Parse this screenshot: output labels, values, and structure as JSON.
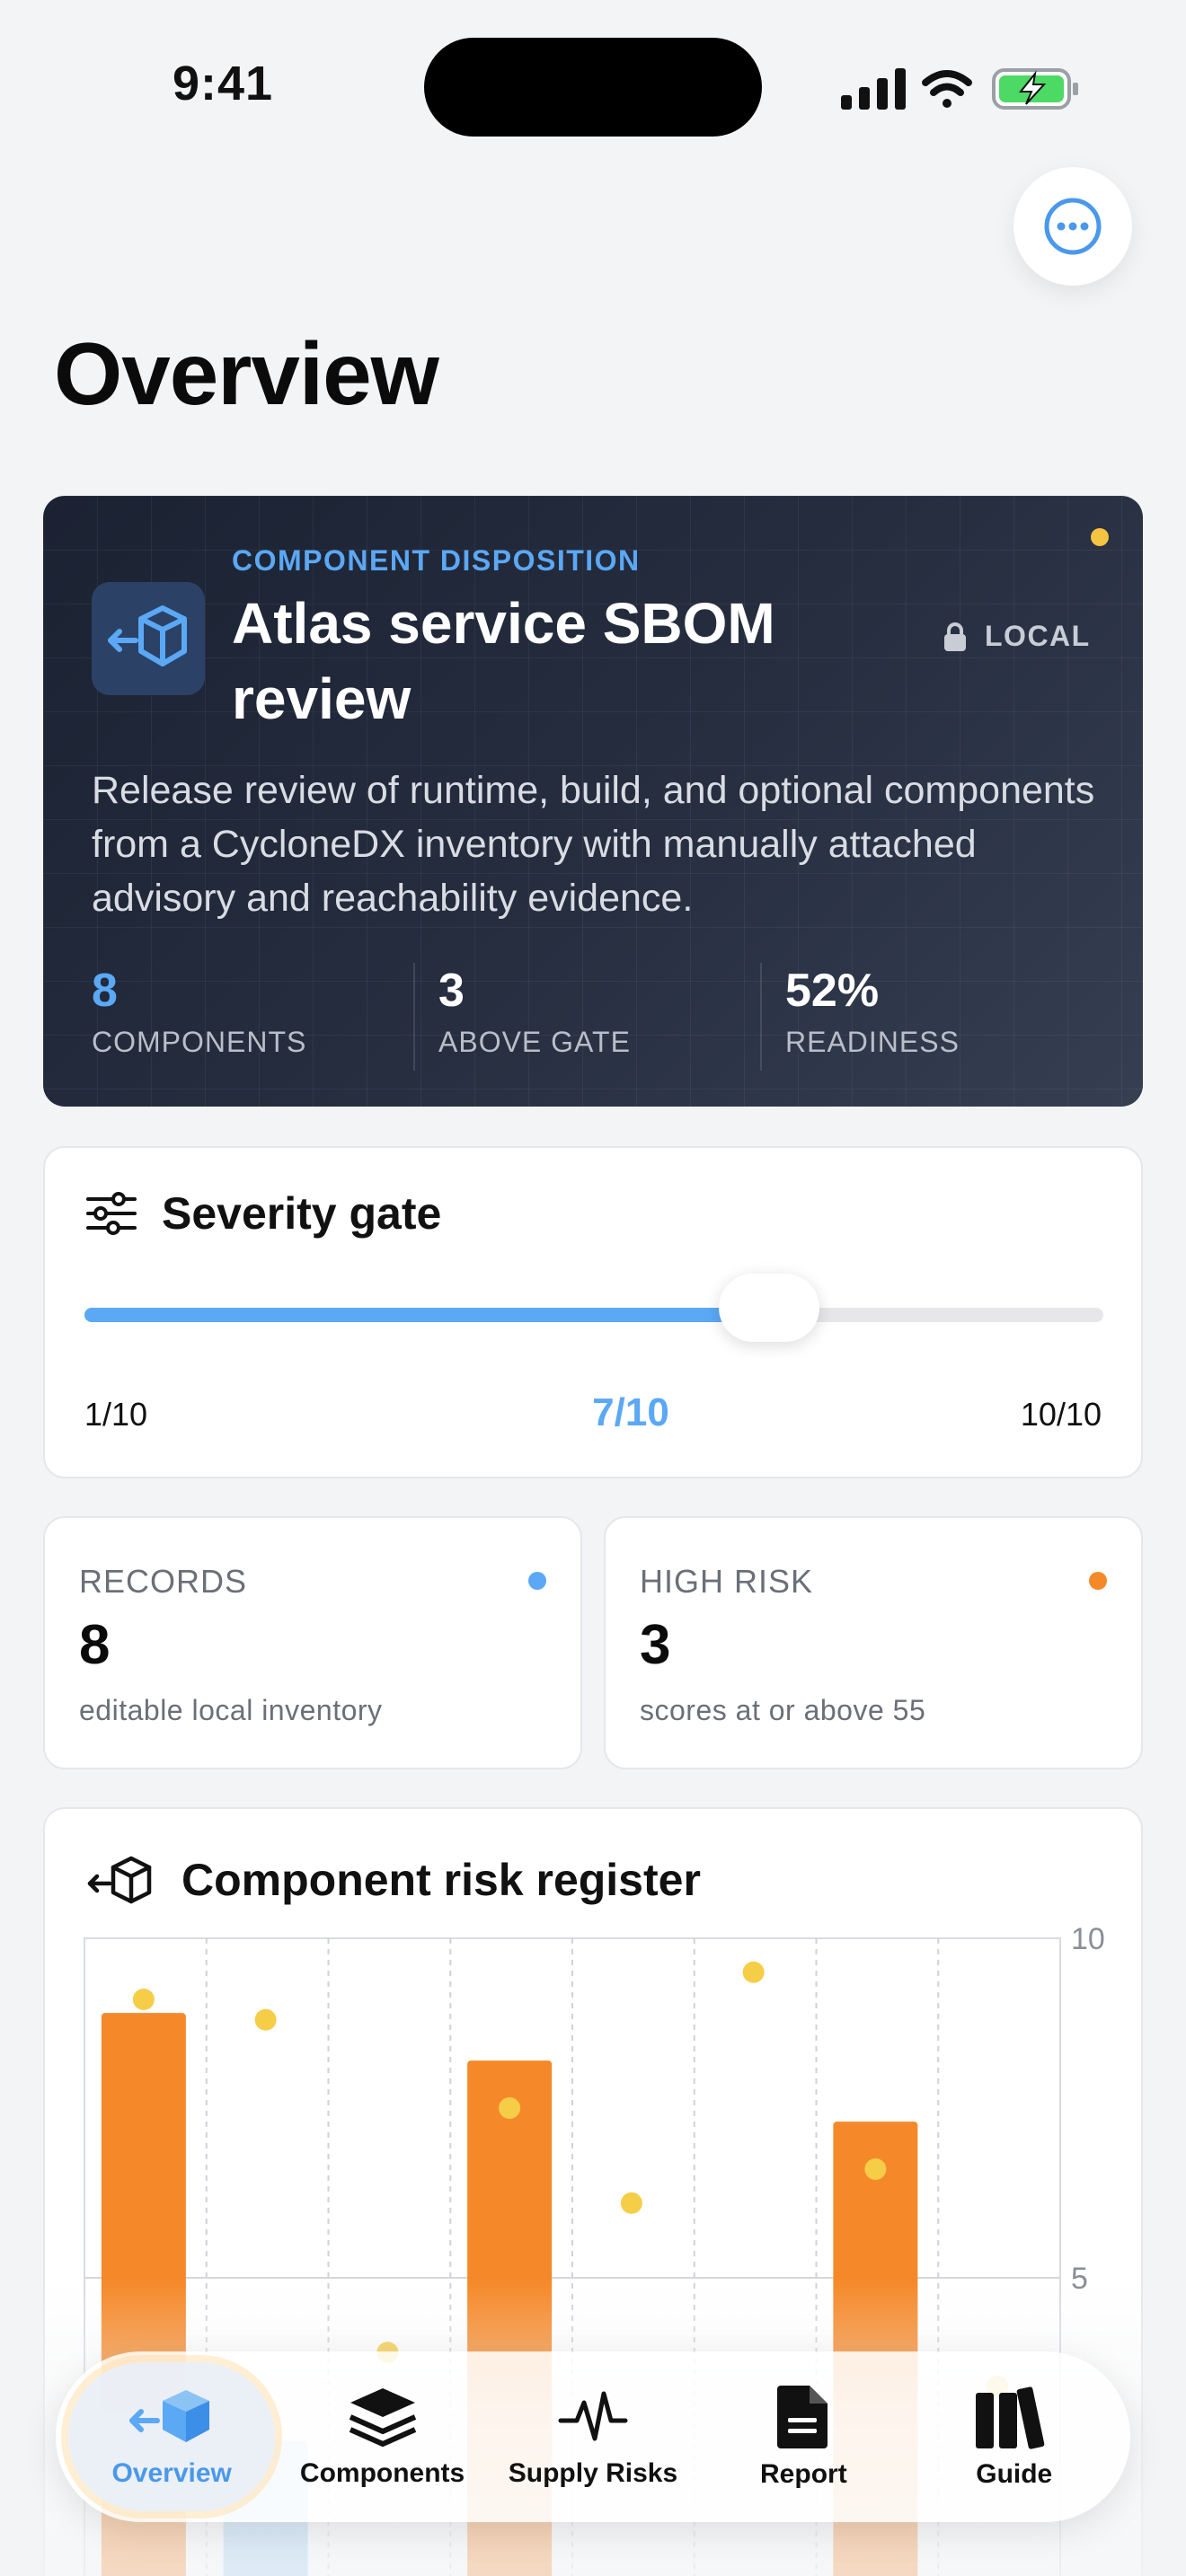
{
  "status_bar": {
    "time": "9:41"
  },
  "page": {
    "title": "Overview"
  },
  "hero": {
    "kicker": "COMPONENT DISPOSITION",
    "title": "Atlas service SBOM review",
    "badge": "LOCAL",
    "description": "Release review of runtime, build, and optional components from a CycloneDX inventory with manually attached advisory and reachability evidence.",
    "stats": [
      {
        "value": "8",
        "label": "COMPONENTS"
      },
      {
        "value": "3",
        "label": "ABOVE GATE"
      },
      {
        "value": "52%",
        "label": "READINESS"
      }
    ],
    "colors": {
      "accent": "#5ba8f5",
      "status_dot": "#f6c343"
    }
  },
  "severity_gate": {
    "title": "Severity gate",
    "min_label": "1/10",
    "value_label": "7/10",
    "max_label": "10/10",
    "min": 1,
    "max": 10,
    "value": 7
  },
  "summary": {
    "records": {
      "label": "RECORDS",
      "value": "8",
      "sub": "editable local inventory",
      "dot_color": "#5ba8f5"
    },
    "high_risk": {
      "label": "HIGH RISK",
      "value": "3",
      "sub": "scores at or above 55",
      "dot_color": "#f5892a"
    }
  },
  "register": {
    "title": "Component risk register",
    "chart_data": {
      "type": "bar",
      "ylim": [
        0,
        10
      ],
      "yticks": [
        "10",
        "5"
      ],
      "series": [
        {
          "values": [
            8.9,
            null,
            null,
            8.2,
            null,
            null,
            7.3,
            null
          ],
          "color": "#f5892a"
        },
        {
          "values": [
            null,
            2.6,
            null,
            null,
            null,
            null,
            null,
            null
          ],
          "color": "#9fd0f5"
        }
      ],
      "points": [
        9.1,
        8.8,
        3.9,
        7.5,
        6.1,
        9.5,
        6.6,
        3.4
      ],
      "point_color": "#f6cd47"
    }
  },
  "tabs": [
    {
      "label": "Overview",
      "icon": "box-arrow-icon",
      "active": true
    },
    {
      "label": "Components",
      "icon": "layers-icon",
      "active": false
    },
    {
      "label": "Supply Risks",
      "icon": "pulse-icon",
      "active": false
    },
    {
      "label": "Report",
      "icon": "document-icon",
      "active": false
    },
    {
      "label": "Guide",
      "icon": "books-icon",
      "active": false
    }
  ]
}
